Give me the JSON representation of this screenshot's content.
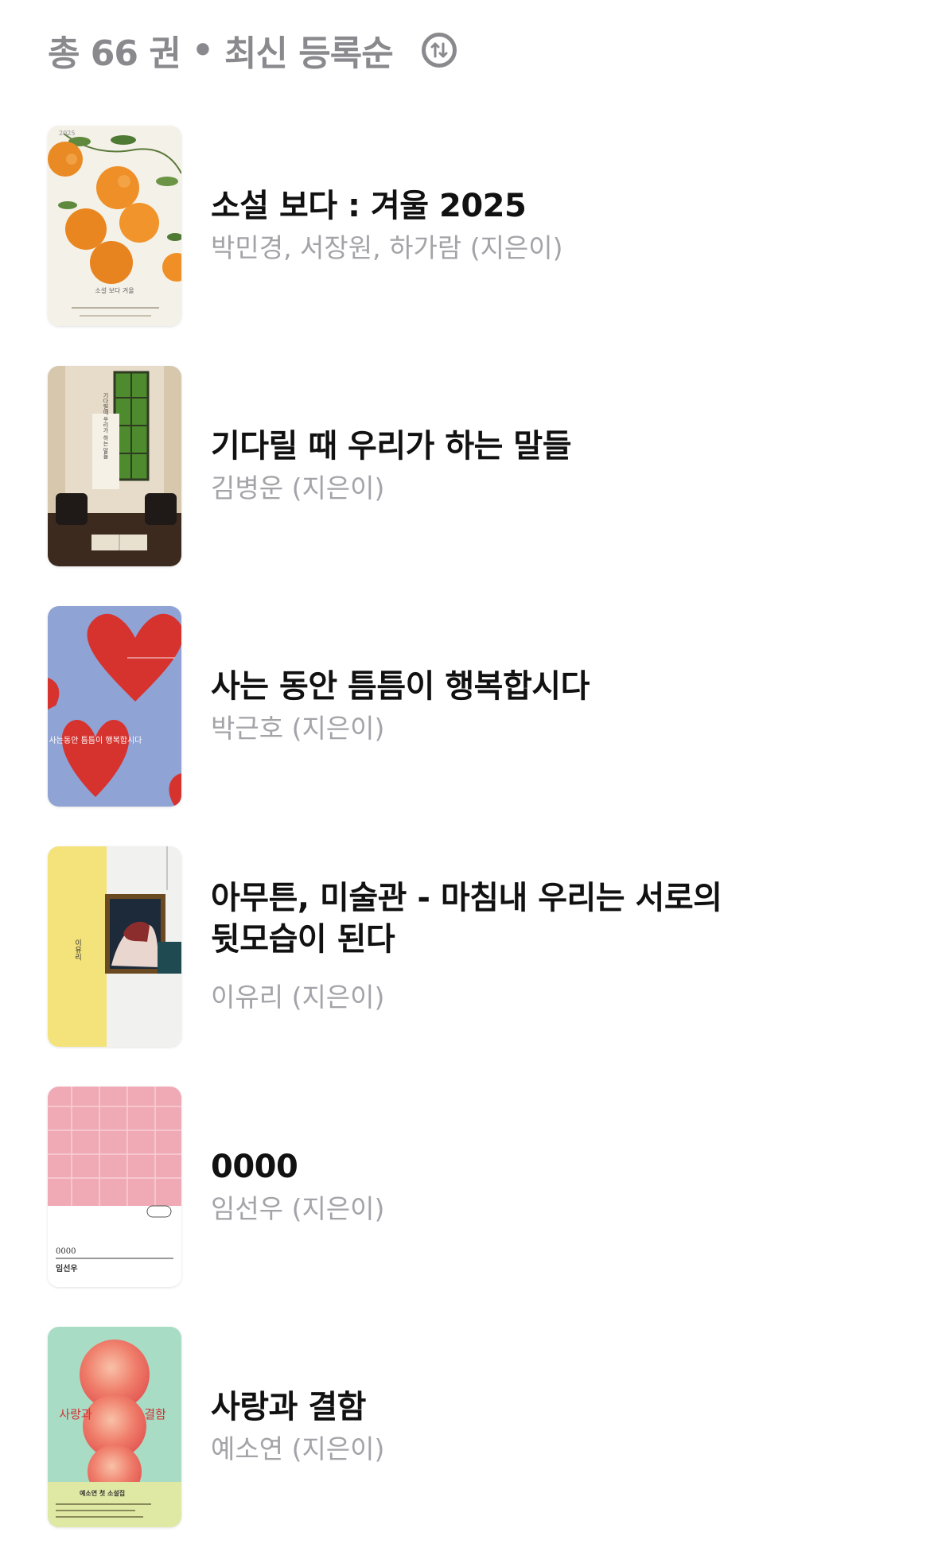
{
  "header": {
    "count_label": "총 66 권",
    "separator": "•",
    "sort_label": "최신 등록순"
  },
  "books": [
    {
      "title": "소설 보다 : 겨울 2025",
      "author": "박민경, 서장원, 하가람 (지은이)",
      "cover_text": [
        "2025",
        "소설 보다 겨울"
      ]
    },
    {
      "title": "기다릴 때 우리가 하는 말들",
      "author": "김병운 (지은이)",
      "cover_text": [
        "기다릴때 우리가 하는 말들",
        "김병운 소설집"
      ]
    },
    {
      "title": "사는 동안 틈틈이 행복합시다",
      "author": "박근호 (지은이)",
      "cover_text": [
        "사는동안 틈틈이 행복합시다"
      ]
    },
    {
      "title": "아무튼, 미술관 - 마침내 우리는 서로의 뒷모습이 된다",
      "author": "이유리 (지은이)",
      "cover_text": [
        "이유리"
      ]
    },
    {
      "title": "0000",
      "author": "임선우 (지은이)",
      "cover_text": [
        "0000",
        "임선우"
      ]
    },
    {
      "title": "사랑과 결함",
      "author": "예소연 (지은이)",
      "cover_text": [
        "사랑과",
        "결함",
        "예소연 첫 소설집"
      ]
    }
  ]
}
